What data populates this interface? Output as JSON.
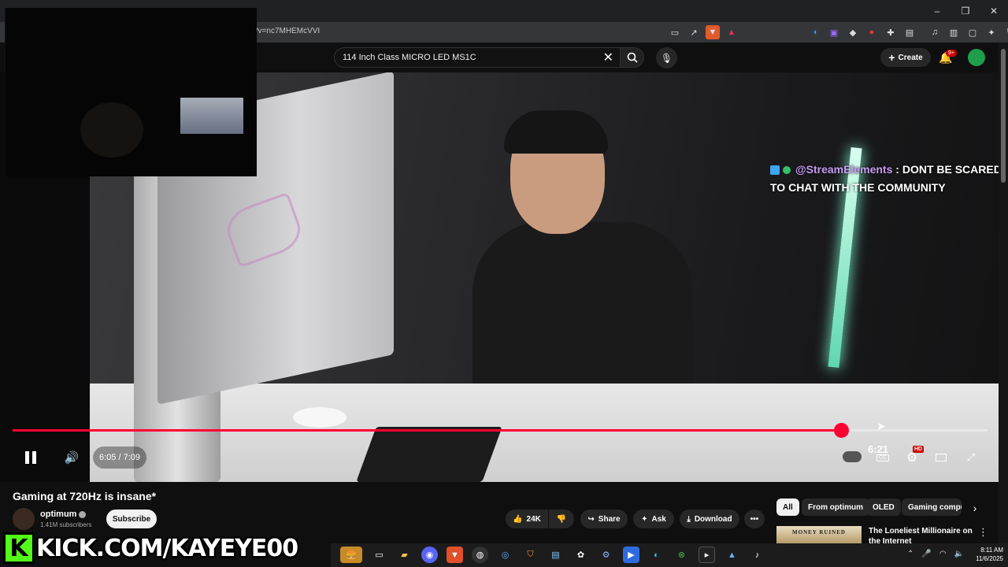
{
  "browser": {
    "url": "?v=nc7MHEMcVVI",
    "window_controls": {
      "minimize": "–",
      "restore": "❐",
      "close": "✕"
    }
  },
  "masthead": {
    "search_value": "114 Inch Class MICRO LED MS1C",
    "create_label": "Create",
    "notifications_badge": "9+"
  },
  "chat_overlay": {
    "user": "@StreamElements",
    "separator": " : ",
    "message": "DONT BE SCARED TO CHAT WITH THE COMMUNITY"
  },
  "player": {
    "time_display": "6:05 / 7:09",
    "hover_time": "6:21",
    "progress_fraction": 0.85,
    "hd_badge": "HD",
    "accent_color": "#ff0033"
  },
  "video": {
    "title": "Gaming at 720Hz is insane*",
    "channel": "optimum",
    "subscribers": "1.41M subscribers",
    "subscribe_label": "Subscribe",
    "likes": "24K",
    "share_label": "Share",
    "ask_label": "Ask",
    "download_label": "Download"
  },
  "chips": [
    "All",
    "From optimum",
    "OLED",
    "Gaming compu"
  ],
  "recommended": {
    "thumb_text": "MONEY RUINED",
    "title": "The Loneliest Millionaire on the Internet"
  },
  "kick": {
    "logo": "K",
    "text": "KICK.COM/KAYEYE00"
  },
  "taskbar": {
    "time": "8:11 AM",
    "date": "11/6/2025"
  }
}
